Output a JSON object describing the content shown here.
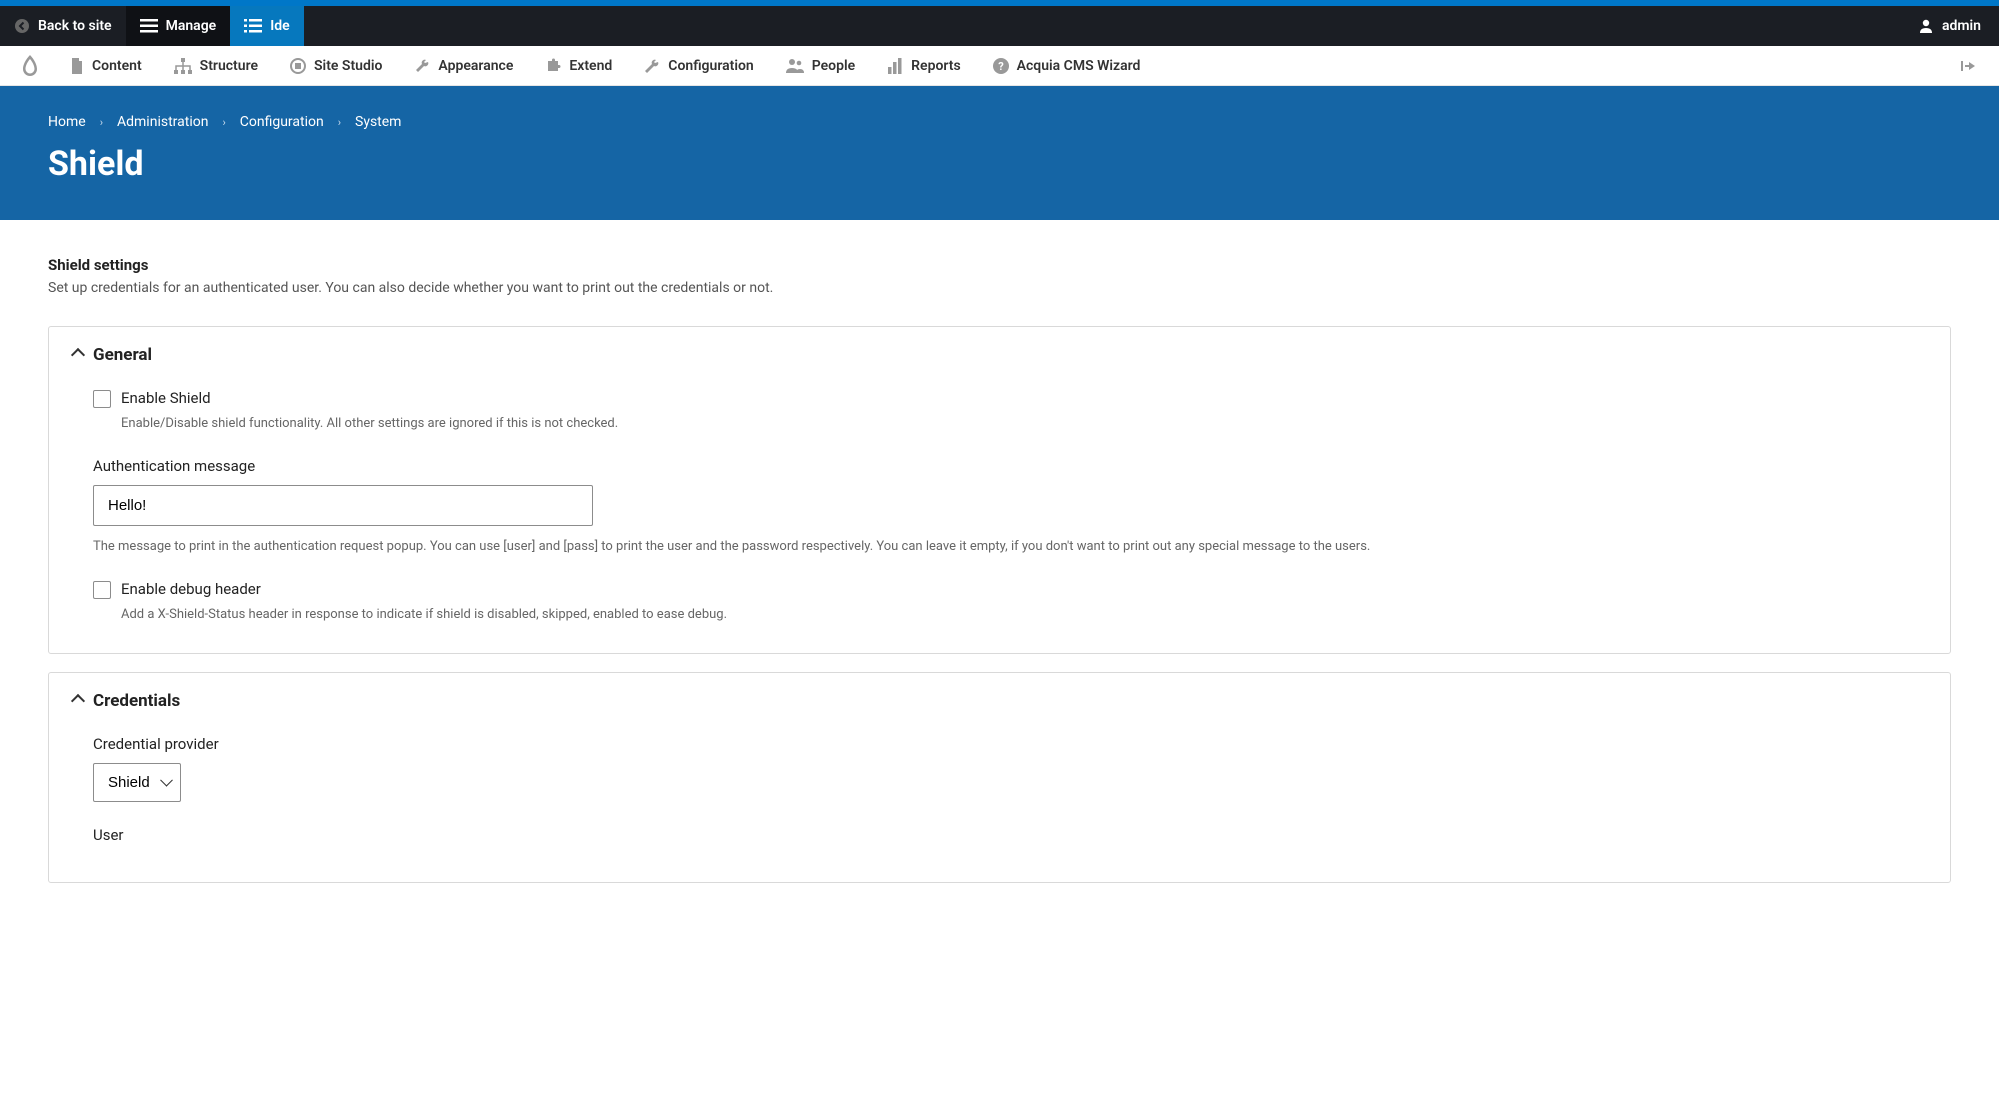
{
  "toolbar": {
    "back": "Back to site",
    "manage": "Manage",
    "ide": "Ide",
    "user": "admin"
  },
  "adminMenu": {
    "items": [
      {
        "label": "Content"
      },
      {
        "label": "Structure"
      },
      {
        "label": "Site Studio"
      },
      {
        "label": "Appearance"
      },
      {
        "label": "Extend"
      },
      {
        "label": "Configuration"
      },
      {
        "label": "People"
      },
      {
        "label": "Reports"
      },
      {
        "label": "Acquia CMS Wizard"
      }
    ]
  },
  "breadcrumb": {
    "items": [
      "Home",
      "Administration",
      "Configuration",
      "System"
    ]
  },
  "pageTitle": "Shield",
  "settings": {
    "title": "Shield settings",
    "desc": "Set up credentials for an authenticated user. You can also decide whether you want to print out the credentials or not."
  },
  "general": {
    "legend": "General",
    "enableShield": {
      "label": "Enable Shield",
      "desc": "Enable/Disable shield functionality. All other settings are ignored if this is not checked."
    },
    "authMessage": {
      "label": "Authentication message",
      "value": "Hello!",
      "desc": "The message to print in the authentication request popup. You can use [user] and [pass] to print the user and the password respectively. You can leave it empty, if you don't want to print out any special message to the users."
    },
    "debugHeader": {
      "label": "Enable debug header",
      "desc": "Add a X-Shield-Status header in response to indicate if shield is disabled, skipped, enabled to ease debug."
    }
  },
  "credentials": {
    "legend": "Credentials",
    "provider": {
      "label": "Credential provider",
      "value": "Shield"
    },
    "user": {
      "label": "User"
    }
  }
}
